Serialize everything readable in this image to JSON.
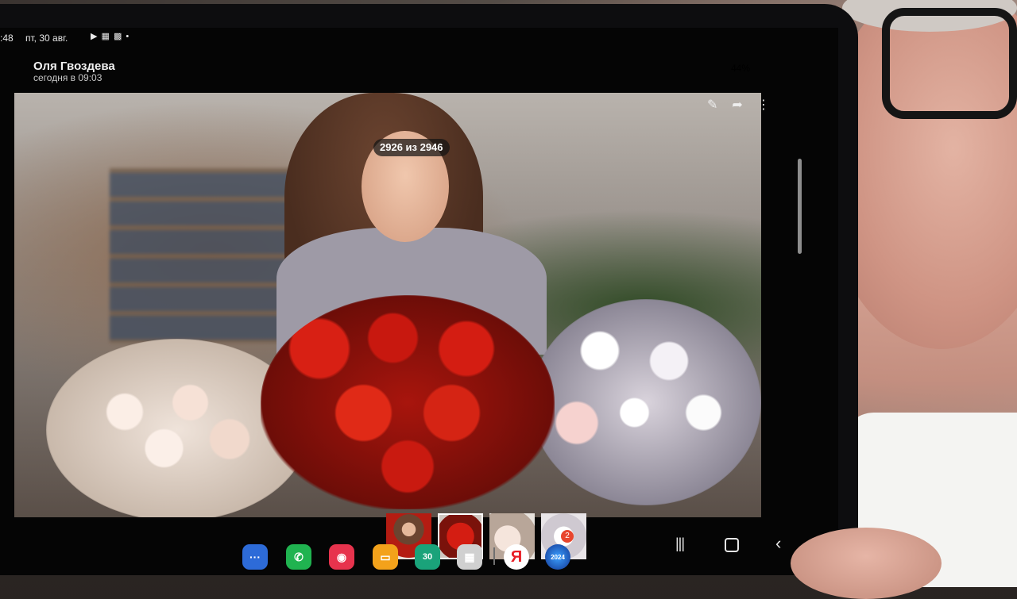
{
  "status_bar": {
    "time": ":48",
    "date": "пт, 30 авг.",
    "battery": "44%"
  },
  "chat": {
    "sender_name": "Оля Гвоздева",
    "sent_time": "сегодня в 09:03"
  },
  "viewer": {
    "counter": "2926 из 2946",
    "icons": [
      "brush-icon",
      "share-icon",
      "more-icon"
    ]
  },
  "thumbnails": [
    {
      "selected": false
    },
    {
      "selected": true
    },
    {
      "selected": false
    },
    {
      "selected": false
    }
  ],
  "dock": {
    "calendar_label": "30",
    "yandex_label": "Я",
    "game_label": "2024",
    "game_badge": "2"
  },
  "colors": {
    "messages": "#2d6bd8",
    "phone": "#20b350",
    "camera": "#e7334d",
    "notes": "#f3a21b",
    "calendar": "#1aa37a",
    "yandex": "#e81d25"
  }
}
